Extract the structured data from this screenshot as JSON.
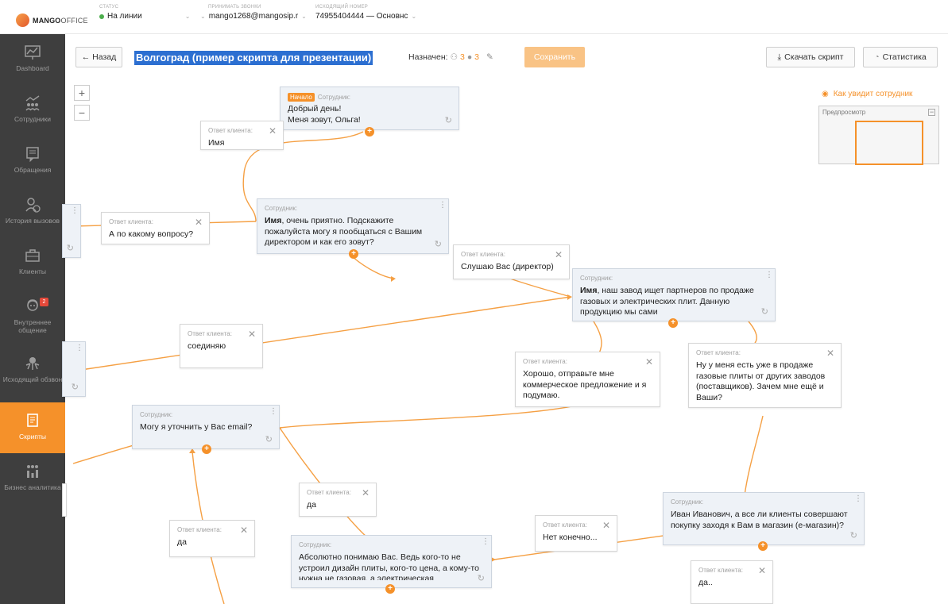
{
  "brand": {
    "name_bold": "MANGO",
    "name_light": "OFFICE"
  },
  "topbar": {
    "status_label": "статус",
    "status_value": "На линии",
    "receive_label": "принимать звонки",
    "receive_value": "mango1268@mangosip.r",
    "outgoing_label": "исходящий номер",
    "outgoing_value": "74955404444 — Основнс"
  },
  "sidebar": {
    "items": [
      {
        "label": "Dashboard",
        "icon": "dashboard-icon"
      },
      {
        "label": "Сотрудники",
        "icon": "employees-icon"
      },
      {
        "label": "Обращения",
        "icon": "requests-icon"
      },
      {
        "label": "История вызовов",
        "icon": "call-history-icon"
      },
      {
        "label": "Клиенты",
        "icon": "clients-icon"
      },
      {
        "label": "Внутреннее общение",
        "icon": "chat-icon",
        "badge": "2"
      },
      {
        "label": "Исходящий обзвон",
        "icon": "dialer-icon"
      },
      {
        "label": "Скрипты",
        "icon": "scripts-icon",
        "active": true
      },
      {
        "label": "Бизнес аналитика",
        "icon": "analytics-icon"
      }
    ]
  },
  "toolbar": {
    "back_label": "← Назад",
    "script_title": "Волгоград (пример скрипта для презентации)",
    "assigned_label": "Назначен:",
    "assigned_groups": "3",
    "assigned_users": "3",
    "save_label": "Сохранить",
    "download_label": "Скачать скрипт",
    "stats_label": "Статистика"
  },
  "preview": {
    "link_label": "Как увидит сотрудник",
    "title": "Предпросмотр"
  },
  "nodes": {
    "start": {
      "badge": "Начало",
      "header": "Сотрудник:",
      "text": "Добрый день!\nМеня зовут, Ольга!"
    },
    "ans_name": {
      "header": "Ответ клиента:",
      "text": "Имя"
    },
    "emp_director": {
      "header": "Сотрудник:",
      "bold": "Имя",
      "text": ", очень приятно. Подскажите пожалуйста могу я пообщаться с Вашим директором и как его зовут?"
    },
    "ans_question": {
      "header": "Ответ клиента:",
      "text": "А по какому вопросу?"
    },
    "ans_listen": {
      "header": "Ответ клиента:",
      "text": "Слушаю Вас (директор)"
    },
    "emp_partners": {
      "header": "Сотрудник:",
      "bold": "Имя",
      "text": ", наш завод ищет партнеров по продаже газовых и электрических плит. Данную продукцию мы сами"
    },
    "ans_connect": {
      "header": "Ответ клиента:",
      "text": "соединяю"
    },
    "ans_ok": {
      "header": "Ответ клиента:",
      "text": "Хорошо, отправьте мне коммерческое предложение и я подумаю."
    },
    "ans_already": {
      "header": "Ответ клиента:",
      "text": "Ну у меня есть уже в продаже газовые плиты от других заводов (поставщиков). Зачем мне ещё и Ваши?"
    },
    "emp_email": {
      "header": "Сотрудник:",
      "text": "Могу я уточнить у Вас email?"
    },
    "ans_yes1": {
      "header": "Ответ клиента:",
      "text": "да"
    },
    "ans_yes2": {
      "header": "Ответ клиента:",
      "text": "да"
    },
    "emp_understand": {
      "header": "Сотрудник:",
      "text": "Абсолютно понимаю Вас. Ведь кого-то не устроил дизайн плиты, кого-то цена, а кому-то нужна не газовая, а электрическая"
    },
    "ans_no": {
      "header": "Ответ клиента:",
      "text": "Нет конечно..."
    },
    "emp_ivan": {
      "header": "Сотрудник:",
      "text": "Иван Иванович, а все ли клиенты совершают покупку заходя к Вам в магазин (е-магазин)?"
    },
    "ans_yes3": {
      "header": "Ответ клиента:",
      "text": "да.."
    }
  }
}
